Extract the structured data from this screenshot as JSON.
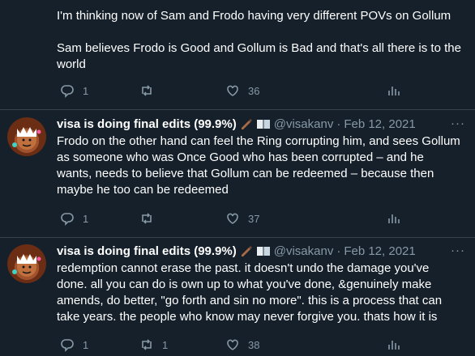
{
  "tweets": [
    {
      "text_p1": "I'm thinking now of Sam and Frodo having very different POVs on Gollum",
      "text_p2": "Sam believes Frodo is Good and Gollum is Bad and that's all there is to the world",
      "replies": "1",
      "retweets": "",
      "likes": "36"
    },
    {
      "name": "visa is doing final edits (99.9%)",
      "handle": "@visakanv",
      "date": "Feb 12, 2021",
      "text": "Frodo on the other hand can feel the Ring corrupting him, and sees Gollum as someone who was Once Good who has been corrupted – and he wants, needs to believe that Gollum can be redeemed – because then maybe he too can be redeemed",
      "replies": "1",
      "retweets": "",
      "likes": "37"
    },
    {
      "name": "visa is doing final edits (99.9%)",
      "handle": "@visakanv",
      "date": "Feb 12, 2021",
      "text": "redemption cannot erase the past. it doesn't undo the damage you've done. all you can do is own up to what you've done, &genuinely make amends, do better, \"go forth and sin no more\". this is a process that can take years. the people who know may never forgive you. thats how it is",
      "replies": "1",
      "retweets": "1",
      "likes": "38"
    }
  ],
  "separator": "·",
  "more": "···",
  "icons": {
    "reply": "reply-icon",
    "retweet": "retweet-icon",
    "like": "heart-icon",
    "analytics": "analytics-icon",
    "writing_hand": "writing-hand-emoji",
    "book": "open-book-emoji"
  },
  "colors": {
    "background": "#15202b",
    "text": "#ffffff",
    "muted": "#8899a6",
    "divider": "#38444d"
  }
}
